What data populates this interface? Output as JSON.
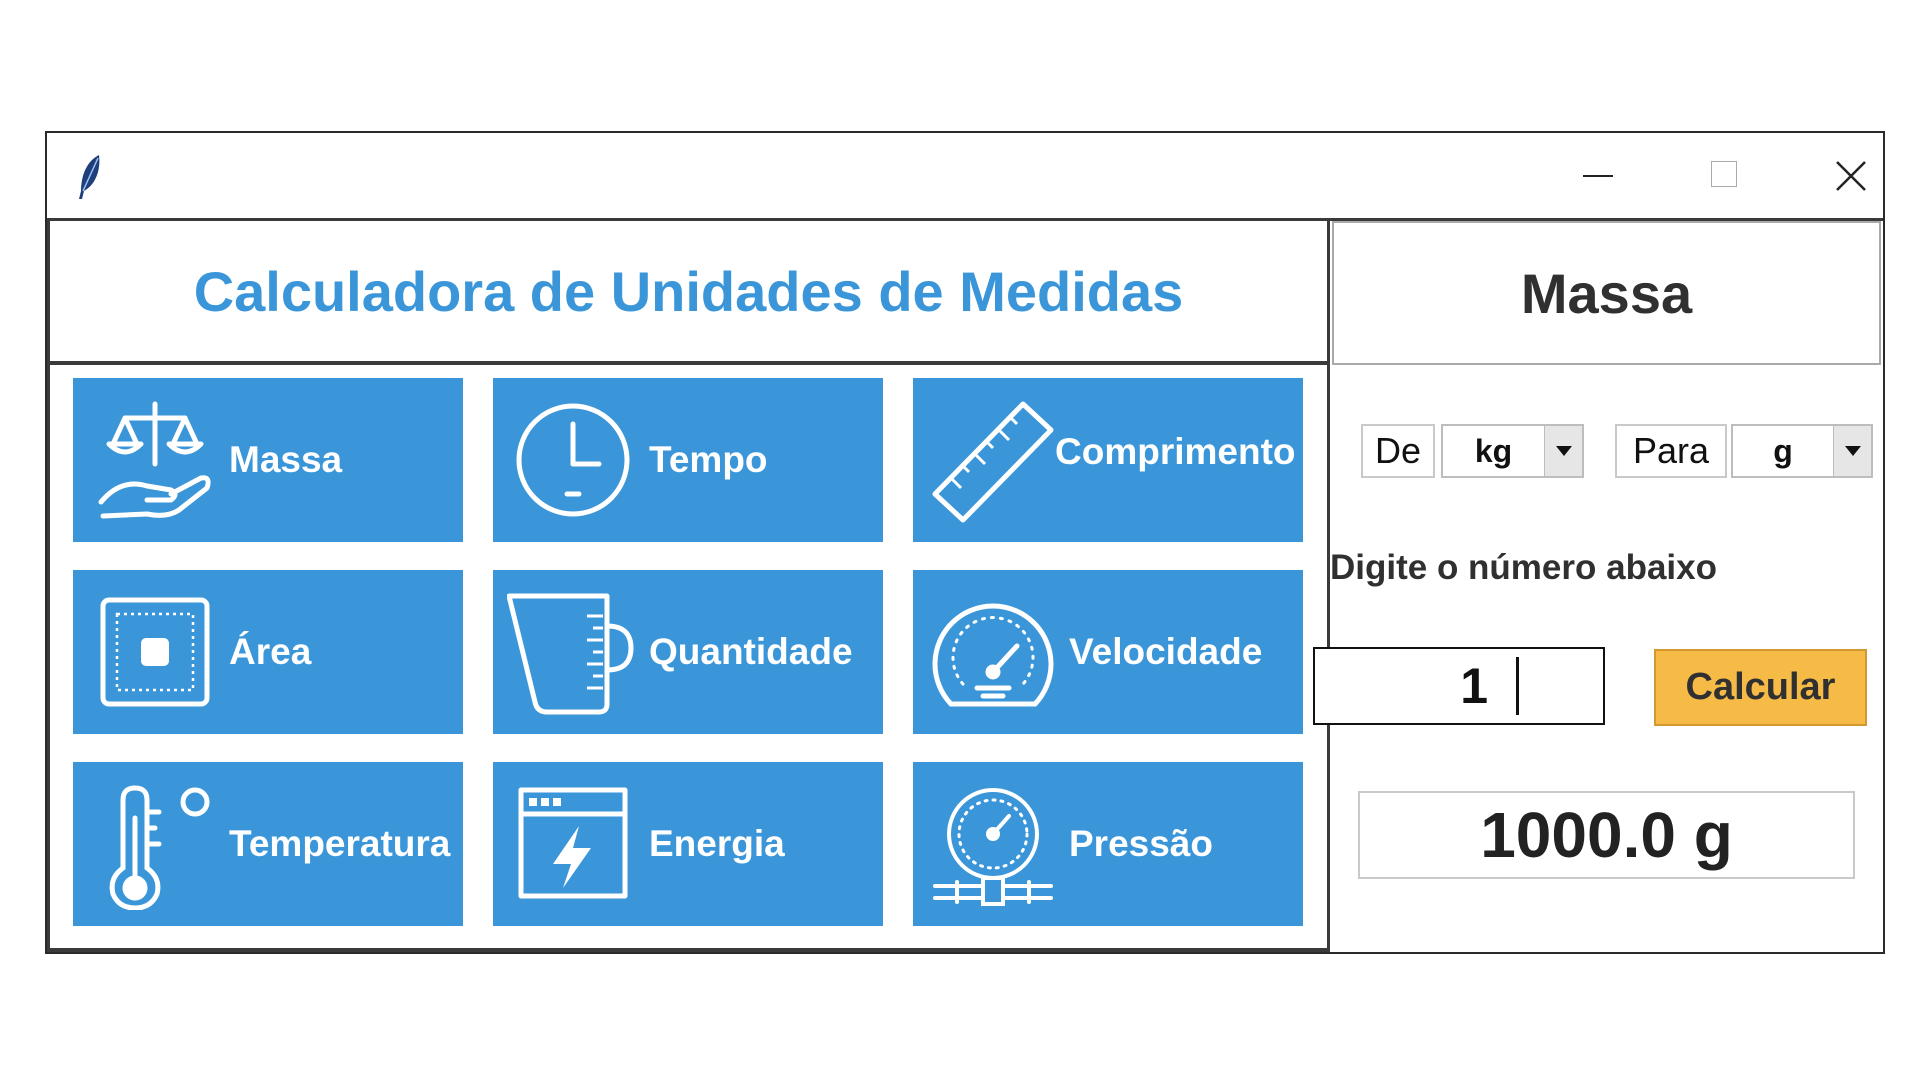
{
  "window": {
    "icon": "feather-icon",
    "controls": [
      "minimize-icon",
      "maximize-icon",
      "close-icon"
    ]
  },
  "app": {
    "title": "Calculadora de Unidades de Medidas"
  },
  "categories": [
    {
      "label": "Massa",
      "icon": "scale-hand-icon"
    },
    {
      "label": "Tempo",
      "icon": "clock-icon"
    },
    {
      "label": "Comprimento",
      "icon": "ruler-icon"
    },
    {
      "label": "Área",
      "icon": "area-square-icon"
    },
    {
      "label": "Quantidade",
      "icon": "measuring-cup-icon"
    },
    {
      "label": "Velocidade",
      "icon": "speedometer-icon"
    },
    {
      "label": "Temperatura",
      "icon": "thermometer-icon"
    },
    {
      "label": "Energia",
      "icon": "energy-window-icon"
    },
    {
      "label": "Pressão",
      "icon": "pressure-gauge-icon"
    }
  ],
  "converter": {
    "title": "Massa",
    "from_label": "De",
    "from_unit": "kg",
    "to_label": "Para",
    "to_unit": "g",
    "prompt": "Digite o número abaixo",
    "input_value": "1",
    "calculate_label": "Calcular",
    "result": "1000.0 g"
  },
  "colors": {
    "accent": "#3a96d9",
    "button": "#f6bb47",
    "tile_text": "#ffffff"
  }
}
